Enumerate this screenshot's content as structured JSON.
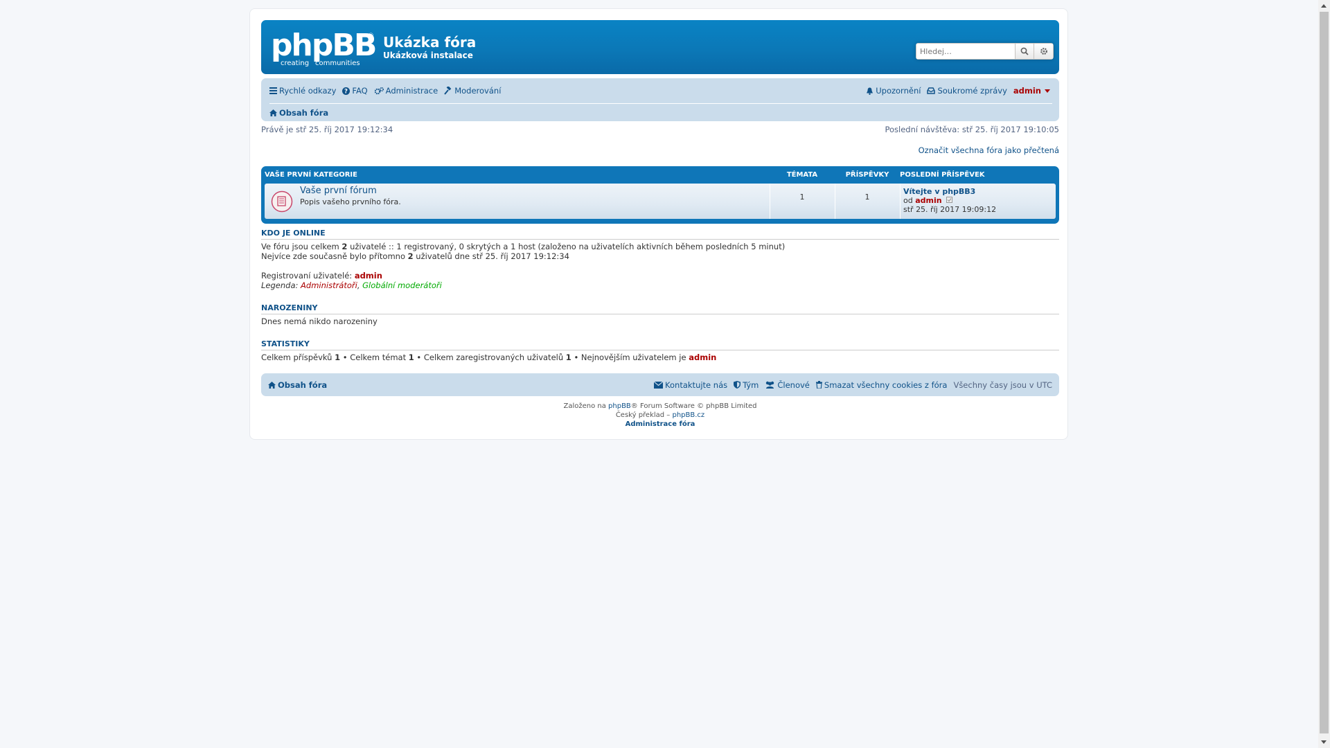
{
  "header": {
    "site_title": "Ukázka fóra",
    "site_description": "Ukázková instalace",
    "logo": {
      "word": "phpBB",
      "reg": "®",
      "tag_left": "creating",
      "tag_right": "communities"
    },
    "search": {
      "placeholder": "Hledej…"
    },
    "accent_color": "#0a78b8"
  },
  "navbar": {
    "quick_links": "Rychlé odkazy",
    "faq": "FAQ",
    "acp": "Administrace",
    "mcp": "Moderování",
    "notifications": "Upozornění",
    "private_messages": "Soukromé zprávy",
    "username": "admin",
    "breadcrumb_home": "Obsah fóra"
  },
  "info": {
    "current_time": "Právě je stř 25. říj 2017 19:12:34",
    "last_visit": "Poslední návštěva: stř 25. říj 2017 19:10:05",
    "mark_read": "Označit všechna fóra jako přečtená"
  },
  "forumlist": {
    "category": "Vaše první kategorie",
    "col_topics": "Témata",
    "col_posts": "Příspěvky",
    "col_last_post": "Poslední příspěvek",
    "forum": {
      "name": "Vaše první fórum",
      "description": "Popis vašeho prvního fóra.",
      "topics": "1",
      "posts": "1",
      "last_post_title": "Vítejte v phpBB3",
      "last_post_by": "od",
      "last_post_author": "admin",
      "last_post_time": "stř 25. říj 2017 19:09:12"
    }
  },
  "online": {
    "heading": "Kdo je online",
    "line1_a": "Ve fóru jsou celkem ",
    "line1_count": "2",
    "line1_b": " uživatelé :: 1 registrovaný, 0 skrytých a 1 host (založeno na uživatelích aktivních během posledních 5 minut)",
    "line2_a": "Nejvíce zde současně bylo přítomno ",
    "line2_count": "2",
    "line2_b": " uživatelů dne stř 25. říj 2017 19:12:34",
    "registered_label": "Registrovaní uživatelé: ",
    "registered_user": "admin",
    "legend_label": "Legenda: ",
    "legend_admins": "Administrátoři",
    "legend_sep": ", ",
    "legend_mods": "Globální moderátoři"
  },
  "birthdays": {
    "heading": "Narozeniny",
    "text": "Dnes nemá nikdo narozeniny"
  },
  "stats": {
    "heading": "Statistiky",
    "posts_label": "Celkem příspěvků ",
    "posts": "1",
    "topics_label": " • Celkem témat ",
    "topics": "1",
    "users_label": " • Celkem zaregistrovaných uživatelů ",
    "users": "1",
    "newest_label": " • Nejnovějším uživatelem je ",
    "newest": "admin"
  },
  "footer": {
    "home": "Obsah fóra",
    "contact": "Kontaktujte nás",
    "team": "Tým",
    "members": "Členové",
    "delete_cookies": "Smazat všechny cookies z fóra",
    "timezone": "Všechny časy jsou v UTC",
    "powered_a": "Založeno na ",
    "powered_link": "phpBB",
    "powered_b": "® Forum Software © phpBB Limited",
    "translation_a": "Český překlad – ",
    "translation_link": "phpBB.cz",
    "admin_panel": "Administrace fóra"
  }
}
